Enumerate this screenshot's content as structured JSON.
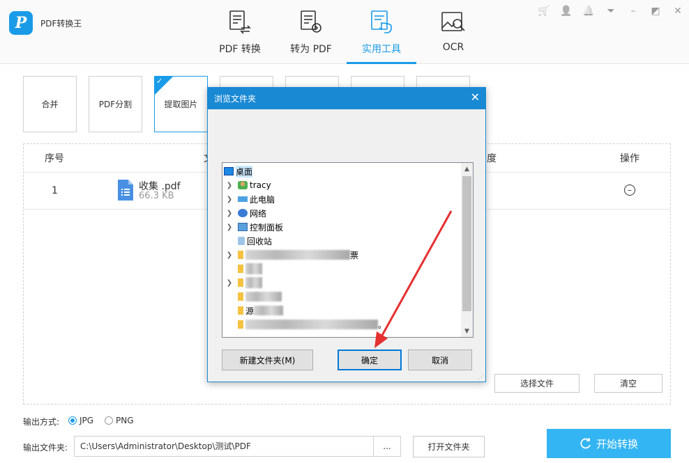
{
  "app": {
    "name": "PDF转换王",
    "logo_letter": "P"
  },
  "nav": [
    {
      "label": "PDF 转换",
      "icon": "pdf-convert-icon"
    },
    {
      "label": "转为 PDF",
      "icon": "to-pdf-icon"
    },
    {
      "label": "实用工具",
      "icon": "tools-icon",
      "active": true
    },
    {
      "label": "OCR",
      "icon": "ocr-icon"
    }
  ],
  "window_controls": {
    "cart": "🛒",
    "user": "👤",
    "bell": "🔔",
    "menu": "⏷",
    "minimize": "–",
    "maximize": "◩",
    "close": "✕"
  },
  "tools": [
    {
      "label": "合并"
    },
    {
      "label": "PDF分割"
    },
    {
      "label": "提取图片",
      "active": true
    }
  ],
  "table": {
    "headers": {
      "index": "序号",
      "file": "文",
      "progress": "度",
      "action": "操作"
    },
    "rows": [
      {
        "index": "1",
        "name": "收集 .pdf",
        "size": "66.3 KB"
      }
    ]
  },
  "buttons": {
    "select_file": "选择文件",
    "clear": "清空",
    "open_folder": "打开文件夹",
    "browse": "...",
    "start": "开始转换"
  },
  "output": {
    "format_label": "输出方式:",
    "formats": [
      {
        "label": "JPG",
        "checked": true
      },
      {
        "label": "PNG",
        "checked": false
      }
    ],
    "folder_label": "输出文件夹:",
    "folder_path": "C:\\Users\\Administrator\\Desktop\\测试\\PDF"
  },
  "dialog": {
    "title": "浏览文件夹",
    "close": "✕",
    "tree": {
      "root": "桌面",
      "items": [
        "tracy",
        "此电脑",
        "网络",
        "控制面板",
        "回收站"
      ],
      "blurred_tail_1": "票",
      "blurred_tail_2": "源",
      "blurred_tail_3": "。"
    },
    "buttons": {
      "new_folder": "新建文件夹(M)",
      "ok": "确定",
      "cancel": "取消"
    },
    "arrow_glyph": "❯"
  },
  "colors": {
    "accent": "#1a9be8",
    "start_button": "#33b5f3",
    "dialog_border": "#1a89d4",
    "annotation_arrow": "#e53030"
  }
}
